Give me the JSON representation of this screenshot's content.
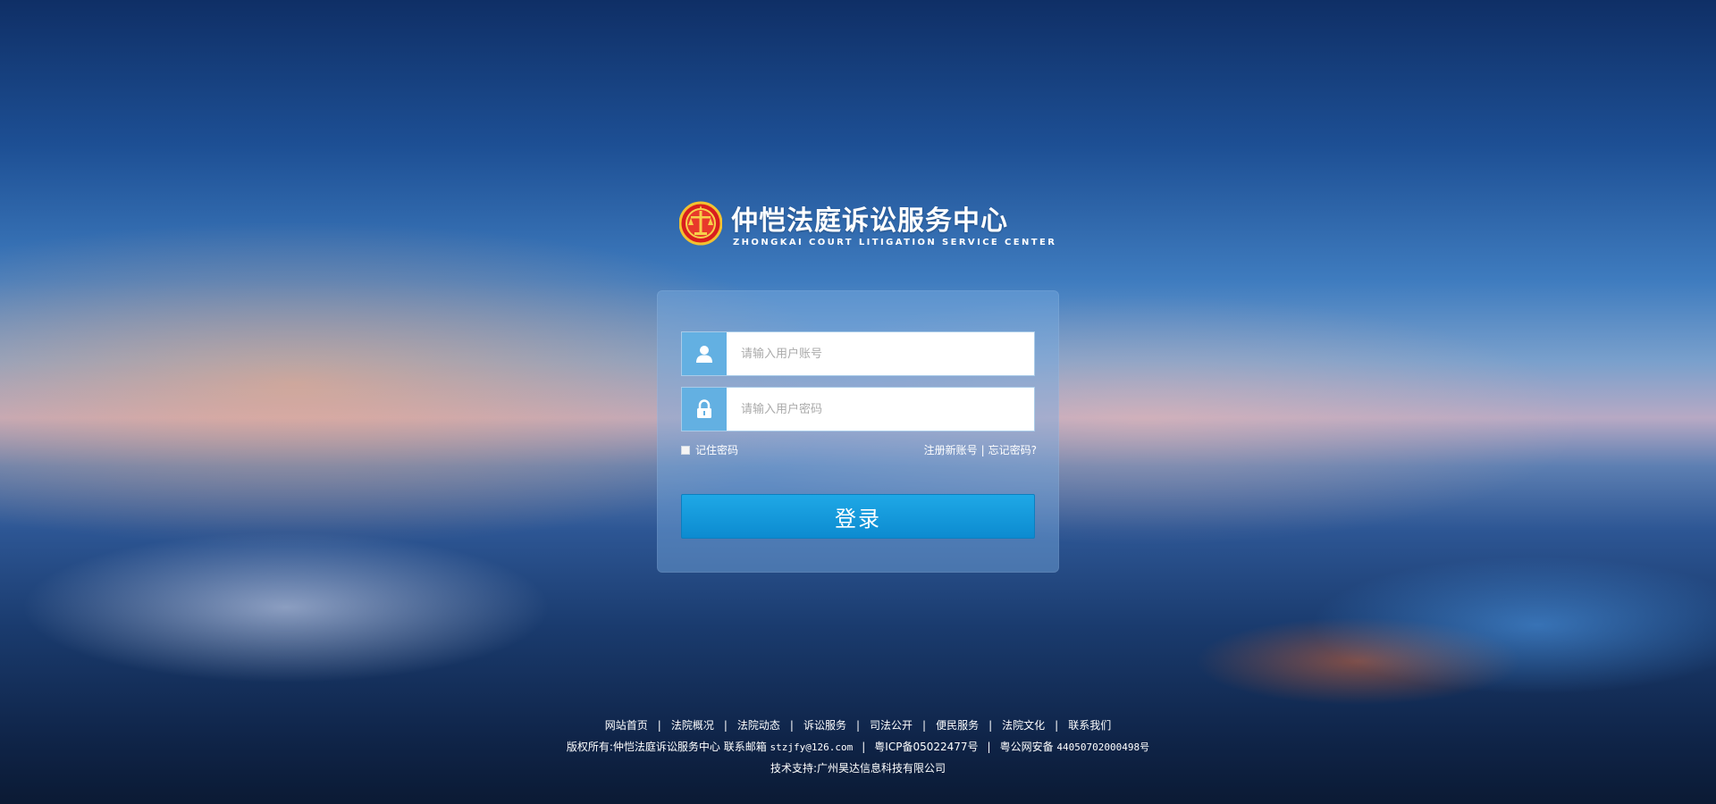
{
  "logo": {
    "title": "仲恺法庭诉讼服务中心",
    "subtitle": "ZHONGKAI COURT LITIGATION SERVICE CENTER"
  },
  "login": {
    "username_placeholder": "请输入用户账号",
    "password_placeholder": "请输入用户密码",
    "remember_label": "记住密码",
    "register_link": "注册新账号",
    "separator": "|",
    "forgot_link": "忘记密码?",
    "submit_label": "登录"
  },
  "footer": {
    "nav": [
      "网站首页",
      "法院概况",
      "法院动态",
      "诉讼服务",
      "司法公开",
      "便民服务",
      "法院文化",
      "联系我们"
    ],
    "nav_separator": "|",
    "copyright_label": "版权所有:仲恺法庭诉讼服务中心 联系邮箱",
    "email": "stzjfy@126.com",
    "icp": "粤ICP备05022477号",
    "police_label": "粤公网安备",
    "police_number": "44050702000498号",
    "tech_support": "技术支持:广州昊达信息科技有限公司"
  },
  "colors": {
    "accent": "#1fa8e6",
    "icon_bg": "#63b0e2"
  }
}
